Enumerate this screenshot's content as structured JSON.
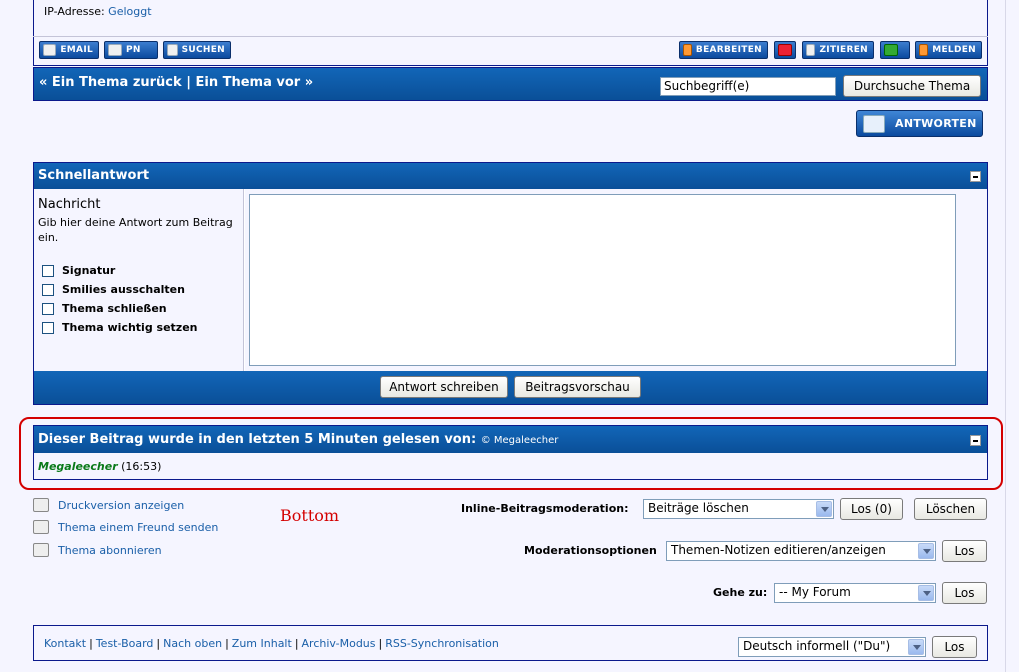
{
  "post": {
    "ip_label": "IP-Adresse:",
    "ip_value": "Geloggt",
    "buttons_left": [
      "EMAIL",
      "PN",
      "SUCHEN"
    ],
    "buttons_right": [
      "BEARBEITEN",
      "ZITIEREN",
      "MELDEN"
    ]
  },
  "thread_nav": {
    "prev": "« Ein Thema zurück",
    "separator": "|",
    "next": "Ein Thema vor »",
    "search_value": "Suchbegriff(e)",
    "search_button": "Durchsuche Thema"
  },
  "reply_button": "ANTWORTEN",
  "quick_reply": {
    "title": "Schnellantwort",
    "message_label": "Nachricht",
    "message_hint": "Gib hier deine Antwort zum Beitrag ein.",
    "options": [
      "Signatur",
      "Smilies ausschalten",
      "Thema schließen",
      "Thema wichtig setzen"
    ],
    "submit": "Antwort schreiben",
    "preview": "Beitragsvorschau"
  },
  "readers": {
    "title": "Dieser Beitrag wurde in den letzten 5 Minuten gelesen von:",
    "credit": "© Megaleecher",
    "name": "Megaleecher",
    "time": "(16:53)"
  },
  "annotation": "Bottom",
  "tools": [
    "Druckversion anzeigen",
    "Thema einem Freund senden",
    "Thema abonnieren"
  ],
  "moderation": {
    "inline_label": "Inline-Beitragsmoderation:",
    "inline_value": "Beiträge löschen",
    "inline_go": "Los (0)",
    "inline_delete": "Löschen",
    "options_label": "Moderationsoptionen",
    "options_value": "Themen-Notizen editieren/anzeigen",
    "options_go": "Los"
  },
  "jump": {
    "label": "Gehe zu:",
    "value": "-- My Forum",
    "go": "Los"
  },
  "footer": {
    "links": [
      "Kontakt",
      "Test-Board",
      "Nach oben",
      "Zum Inhalt",
      "Archiv-Modus",
      "RSS-Synchronisation"
    ],
    "language": "Deutsch informell (\"Du\")",
    "go": "Los"
  }
}
